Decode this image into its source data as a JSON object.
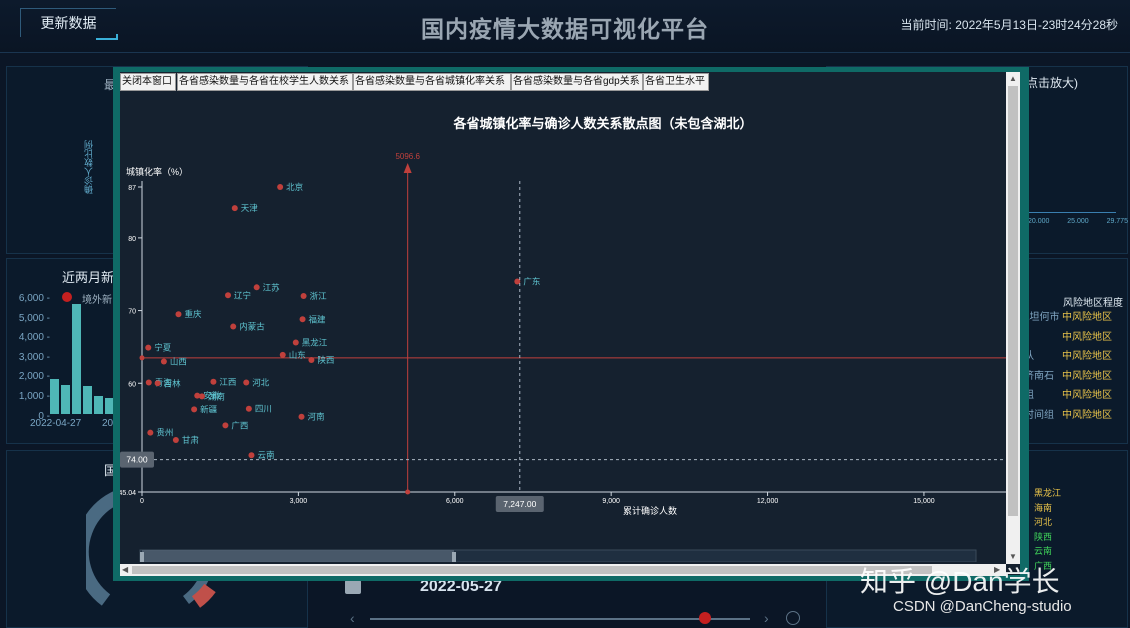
{
  "header": {
    "update_label": "更新数据",
    "title": "国内疫情大数据可视化平台",
    "time_label": "当前时间:",
    "time_value": "2022年5月13日-23时24分28秒"
  },
  "background": {
    "left_panel_title": "近两月新",
    "left_legend": "境外新",
    "left_y_ticks": [
      "6,000 -",
      "5,000 -",
      "4,000 -",
      "3,000 -",
      "2,000 -",
      "1,000 -",
      "0 -"
    ],
    "left_bar_values": [
      1800,
      1500,
      5600,
      1400,
      900,
      800
    ],
    "left_date": "2022-04-27",
    "left_date2": "20",
    "right_top_text": "点击放大)",
    "right_axis_ticks": [
      "20.000",
      "25.000",
      "29.775"
    ],
    "risk_header": "风险地区程度",
    "risk_rows": [
      "中风险地区",
      "中风险地区",
      "中风险地区",
      "中风险地区",
      "中风险地区",
      "中风险地区"
    ],
    "risk_places": [
      "L坦何市",
      "",
      "队",
      "济南石",
      "姐",
      "时间组"
    ],
    "bottom_left_title": "国",
    "bottom_date": "2022-05-27",
    "right_bottom_labels": [
      "黑龙江",
      "海南",
      "河北",
      "陕西",
      "云南",
      "广西"
    ],
    "small_left_text": "最",
    "rotated_label": "确诊人数比例"
  },
  "modal": {
    "buttons": [
      "关闭本窗口",
      "各省感染数量与各省在校学生人数关系",
      "各省感染数量与各省城镇化率关系",
      "各省感染数量与各省gdp关系",
      "各省卫生水平"
    ]
  },
  "chart_data": {
    "type": "scatter",
    "title": "各省城镇化率与确诊人数关系散点图（未包含湖北）",
    "xlabel": "累计确诊人数",
    "ylabel": "城镇化率（%）",
    "xlim": [
      0,
      15500
    ],
    "ylim": [
      45.04,
      87
    ],
    "x_ticks": [
      "0",
      "3,000",
      "6,000",
      "9,000",
      "12,000",
      "15,000"
    ],
    "x_tick_values": [
      0,
      3000,
      6000,
      9000,
      12000,
      15000
    ],
    "y_ticks": [
      "87",
      "80",
      "70",
      "60",
      "45.04"
    ],
    "y_tick_values": [
      87,
      80,
      70,
      60,
      45.04
    ],
    "markline_x": 5096.6,
    "markline_x_label": "5096.6",
    "markline_y": 63.5,
    "crosshair_x_label": "7,247.00",
    "crosshair_y_label": "74.00",
    "crosshair_x": 7247,
    "crosshair_y": 49.5,
    "points": [
      {
        "name": "北京",
        "x": 2650,
        "y": 87
      },
      {
        "name": "天津",
        "x": 1780,
        "y": 84.1
      },
      {
        "name": "江苏",
        "x": 2200,
        "y": 73.2
      },
      {
        "name": "辽宁",
        "x": 1650,
        "y": 72.1
      },
      {
        "name": "浙江",
        "x": 3100,
        "y": 72.0
      },
      {
        "name": "广东",
        "x": 7200,
        "y": 74.0
      },
      {
        "name": "重庆",
        "x": 700,
        "y": 69.5
      },
      {
        "name": "内蒙古",
        "x": 1750,
        "y": 67.8
      },
      {
        "name": "福建",
        "x": 3080,
        "y": 68.8
      },
      {
        "name": "黑龙江",
        "x": 2950,
        "y": 65.6
      },
      {
        "name": "宁夏",
        "x": 120,
        "y": 64.9
      },
      {
        "name": "山东",
        "x": 2700,
        "y": 63.9
      },
      {
        "name": "陕西",
        "x": 3250,
        "y": 63.2
      },
      {
        "name": "山西",
        "x": 420,
        "y": 63.0
      },
      {
        "name": "青海",
        "x": 130,
        "y": 60.1
      },
      {
        "name": "吉林",
        "x": 300,
        "y": 60.0
      },
      {
        "name": "江西",
        "x": 1370,
        "y": 60.2
      },
      {
        "name": "河北",
        "x": 2000,
        "y": 60.1
      },
      {
        "name": "安徽",
        "x": 1060,
        "y": 58.3
      },
      {
        "name": "湖南",
        "x": 1150,
        "y": 58.2
      },
      {
        "name": "新疆",
        "x": 1000,
        "y": 56.4
      },
      {
        "name": "四川",
        "x": 2050,
        "y": 56.5
      },
      {
        "name": "河南",
        "x": 3060,
        "y": 55.4
      },
      {
        "name": "广西",
        "x": 1600,
        "y": 54.2
      },
      {
        "name": "贵州",
        "x": 160,
        "y": 53.2
      },
      {
        "name": "甘肃",
        "x": 650,
        "y": 52.2
      },
      {
        "name": "云南",
        "x": 2100,
        "y": 50.1
      }
    ]
  },
  "watermark": {
    "zhihu": "知乎 @Dan学长",
    "csdn": "CSDN @DanCheng-studio"
  }
}
